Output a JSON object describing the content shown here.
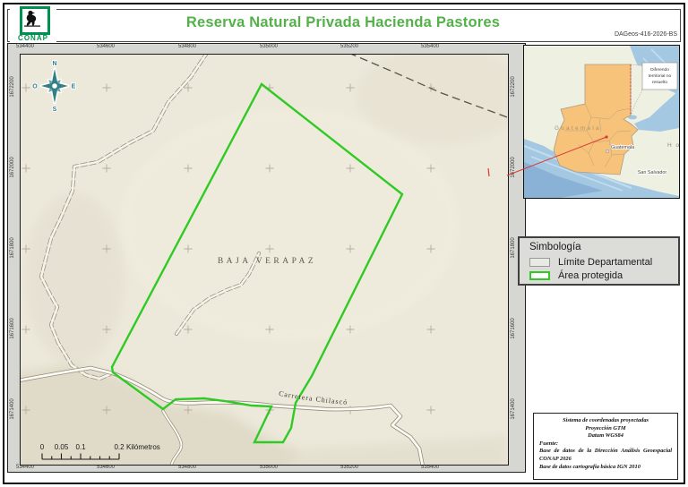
{
  "header": {
    "title": "Reserva Natural Privada Hacienda Pastores",
    "logo_text": "CONAP",
    "doc_code": "DAGeos-416-2026-BS"
  },
  "map": {
    "x_ticks": [
      "534400",
      "534600",
      "534800",
      "535000",
      "535200",
      "535400"
    ],
    "y_ticks": [
      "1672200",
      "1672000",
      "1671800",
      "1671600",
      "1671400"
    ],
    "department_label": "BAJA VERAPAZ",
    "road_label": "Carretera Chilascó",
    "compass": {
      "north": "N",
      "east": "E",
      "south": "S",
      "west": "O"
    },
    "scale_bar": {
      "tick_labels": [
        "0",
        "0.05",
        "0.1",
        "0.2"
      ],
      "unit": "Kilómetros"
    }
  },
  "inset": {
    "country_label": "Guatemala",
    "capital_label": "Guatemala",
    "san_salvador_label": "San Salvador",
    "honduras_partial_label": "H o",
    "note_lines": [
      "Diferendo",
      "territorial no",
      "resuelto"
    ]
  },
  "legend": {
    "title": "Simbología",
    "items": [
      {
        "label": "Límite Departamental"
      },
      {
        "label": "Área protegida"
      }
    ]
  },
  "credits": {
    "crs_line1": "Sistema de coordenadas proyectadas",
    "crs_line2": "Proyección GTM",
    "crs_line3": "Datum WGS84",
    "source_label": "Fuente:",
    "source_line1": "Base de datos de la Dirección Análisis Geoespacial CONAP 2026",
    "source_line2": "Base de datos cartografía básica IGN 2010"
  },
  "colors": {
    "title_green": "#54b14a",
    "conap_green": "#00914e",
    "protected_area_green": "#2fcb24",
    "guatemala_fill": "#f7c279",
    "sea_blue": "#a4c8e2",
    "leader_red": "#d93a35"
  }
}
